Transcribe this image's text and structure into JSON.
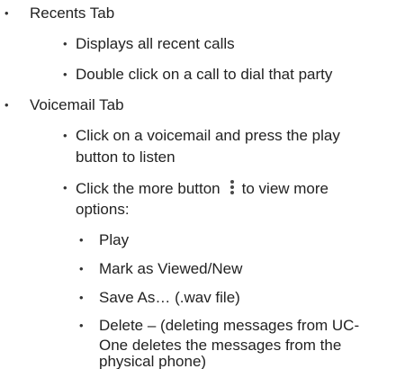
{
  "bullets": {
    "level1": "•",
    "level2": "•",
    "level3": "•"
  },
  "recents": {
    "title": "Recents Tab",
    "items": [
      "Displays all recent calls",
      "Double click on a call to dial that party"
    ]
  },
  "voicemail": {
    "title": "Voicemail Tab",
    "item1_line1": "Click on a voicemail and press the play",
    "item1_line2": "button to listen",
    "item2_before": "Click the more button",
    "item2_after": "to view more",
    "item2_line2": "options:",
    "more_icon": "vertical-ellipsis-icon",
    "options": {
      "play": "Play",
      "mark": "Mark as Viewed/New",
      "save": "Save As… (.wav file)",
      "delete_line1": "Delete – (deleting messages from UC-",
      "delete_line2": "One deletes the messages from the",
      "delete_line3": "physical phone)"
    }
  }
}
